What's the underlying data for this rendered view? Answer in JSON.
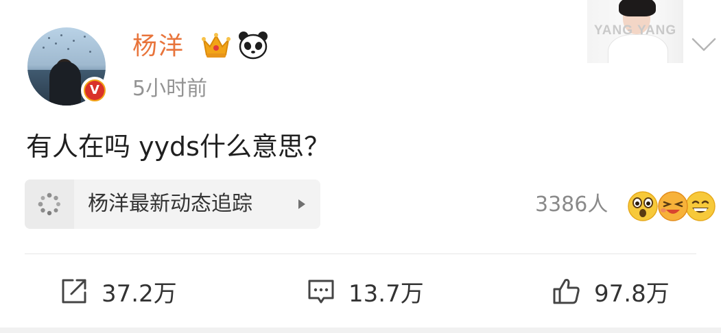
{
  "post": {
    "username": "杨洋",
    "timestamp": "5小时前",
    "text": "有人在吗 yyds什么意思？",
    "verified_badge": "V"
  },
  "header_card": {
    "watermark": "YANG YANG"
  },
  "topic": {
    "label": "杨洋最新动态追踪"
  },
  "reactions": {
    "count": "3386人",
    "emojis": [
      "wow-emoji",
      "laugh-emoji",
      "grin-emoji"
    ]
  },
  "actions": {
    "repost_count": "37.2万",
    "comment_count": "13.7万",
    "like_count": "97.8万"
  },
  "colors": {
    "username": "#e8743b",
    "timestamp": "#939393",
    "text": "#1f1f1f",
    "verified": "#d9322a",
    "crown": "#f2a417"
  }
}
